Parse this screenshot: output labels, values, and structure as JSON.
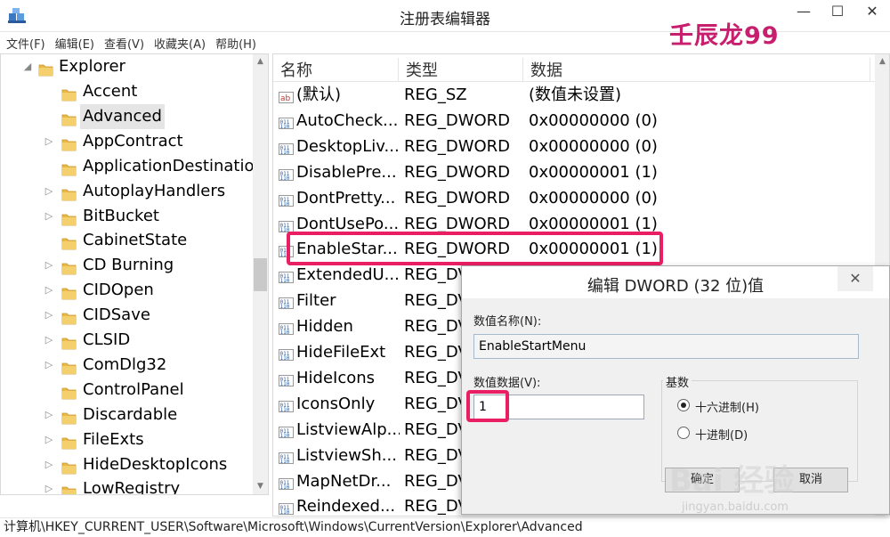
{
  "window": {
    "title": "注册表编辑器",
    "controls": {
      "minimize": "—",
      "maximize": "☐",
      "close": "✕"
    },
    "watermark": "壬辰龙99"
  },
  "menu": [
    "文件(F)",
    "编辑(E)",
    "查看(V)",
    "收藏夹(A)",
    "帮助(H)"
  ],
  "tree": {
    "root": "Explorer",
    "items": [
      {
        "label": "Accent",
        "has_children": false,
        "selected": false
      },
      {
        "label": "Advanced",
        "has_children": false,
        "selected": true
      },
      {
        "label": "AppContract",
        "has_children": true,
        "selected": false
      },
      {
        "label": "ApplicationDestinatio",
        "has_children": false,
        "selected": false
      },
      {
        "label": "AutoplayHandlers",
        "has_children": true,
        "selected": false
      },
      {
        "label": "BitBucket",
        "has_children": true,
        "selected": false
      },
      {
        "label": "CabinetState",
        "has_children": false,
        "selected": false
      },
      {
        "label": "CD Burning",
        "has_children": true,
        "selected": false
      },
      {
        "label": "CIDOpen",
        "has_children": true,
        "selected": false
      },
      {
        "label": "CIDSave",
        "has_children": true,
        "selected": false
      },
      {
        "label": "CLSID",
        "has_children": true,
        "selected": false
      },
      {
        "label": "ComDlg32",
        "has_children": true,
        "selected": false
      },
      {
        "label": "ControlPanel",
        "has_children": false,
        "selected": false
      },
      {
        "label": "Discardable",
        "has_children": true,
        "selected": false
      },
      {
        "label": "FileExts",
        "has_children": true,
        "selected": false
      },
      {
        "label": "HideDesktopIcons",
        "has_children": true,
        "selected": false
      },
      {
        "label": "LowRegistry",
        "has_children": true,
        "selected": false
      }
    ]
  },
  "list": {
    "columns": [
      "名称",
      "类型",
      "数据"
    ],
    "rows": [
      {
        "icon": "string-value-icon",
        "name": "(默认)",
        "type": "REG_SZ",
        "data": "(数值未设置)"
      },
      {
        "icon": "binary-value-icon",
        "name": "AutoCheck...",
        "type": "REG_DWORD",
        "data": "0x00000000 (0)"
      },
      {
        "icon": "binary-value-icon",
        "name": "DesktopLiv...",
        "type": "REG_DWORD",
        "data": "0x00000000 (0)"
      },
      {
        "icon": "binary-value-icon",
        "name": "DisablePre...",
        "type": "REG_DWORD",
        "data": "0x00000001 (1)"
      },
      {
        "icon": "binary-value-icon",
        "name": "DontPretty...",
        "type": "REG_DWORD",
        "data": "0x00000000 (0)"
      },
      {
        "icon": "binary-value-icon",
        "name": "DontUsePo...",
        "type": "REG_DWORD",
        "data": "0x00000001 (1)"
      },
      {
        "icon": "binary-value-icon",
        "name": "EnableStar...",
        "type": "REG_DWORD",
        "data": "0x00000001 (1)"
      },
      {
        "icon": "binary-value-icon",
        "name": "ExtendedU...",
        "type": "REG_DV",
        "data": ""
      },
      {
        "icon": "binary-value-icon",
        "name": "Filter",
        "type": "REG_DV",
        "data": ""
      },
      {
        "icon": "binary-value-icon",
        "name": "Hidden",
        "type": "REG_DV",
        "data": ""
      },
      {
        "icon": "binary-value-icon",
        "name": "HideFileExt",
        "type": "REG_DV",
        "data": ""
      },
      {
        "icon": "binary-value-icon",
        "name": "HideIcons",
        "type": "REG_DV",
        "data": ""
      },
      {
        "icon": "binary-value-icon",
        "name": "IconsOnly",
        "type": "REG_DV",
        "data": ""
      },
      {
        "icon": "binary-value-icon",
        "name": "ListviewAlp...",
        "type": "REG_DV",
        "data": ""
      },
      {
        "icon": "binary-value-icon",
        "name": "ListviewSh...",
        "type": "REG_DV",
        "data": ""
      },
      {
        "icon": "binary-value-icon",
        "name": "MapNetDr...",
        "type": "REG_DV",
        "data": ""
      },
      {
        "icon": "binary-value-icon",
        "name": "Reindexed...",
        "type": "REG_DV",
        "data": ""
      }
    ]
  },
  "status": "计算机\\HKEY_CURRENT_USER\\Software\\Microsoft\\Windows\\CurrentVersion\\Explorer\\Advanced",
  "dialog": {
    "title": "编辑 DWORD (32 位)值",
    "close": "✕",
    "name_label": "数值名称(N):",
    "name_value": "EnableStartMenu",
    "data_label": "数值数据(V):",
    "data_value": "1",
    "base_label": "基数",
    "radio_hex": "十六进制(H)",
    "radio_dec": "十进制(D)",
    "base_selected": "hex",
    "ok": "确定",
    "cancel": "取消"
  },
  "watermarks": {
    "brand": "Bai 经验",
    "url": "jingyan.baidu.com"
  },
  "colors": {
    "highlight": "#e91e63",
    "folder": "#e8b84a"
  }
}
